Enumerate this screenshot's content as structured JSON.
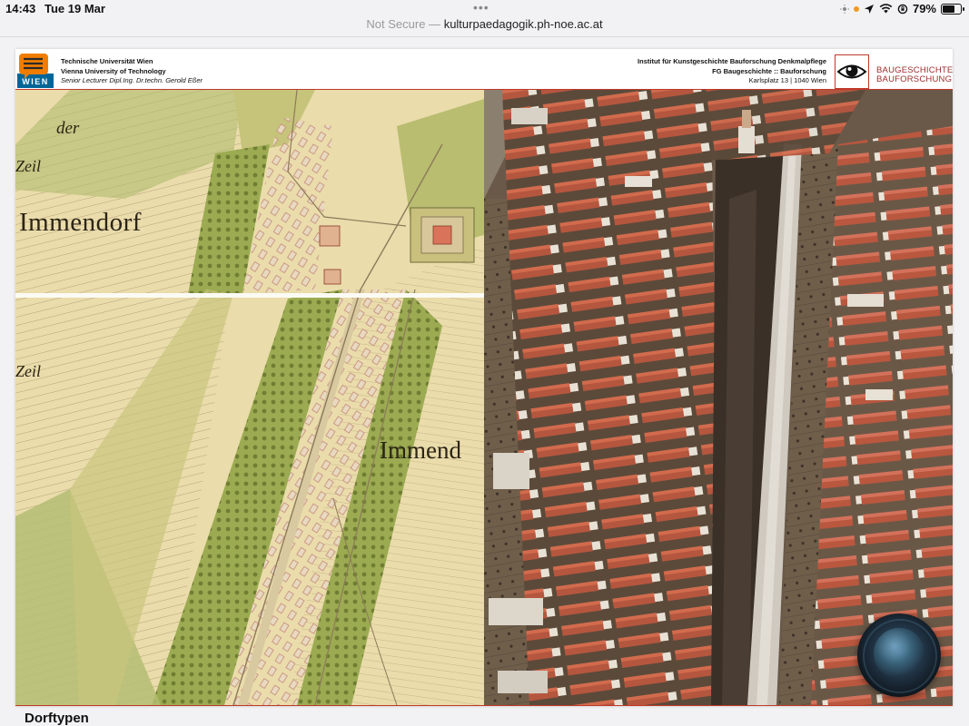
{
  "status_bar": {
    "time": "14:43",
    "date": "Tue 19 Mar",
    "battery": "79%",
    "battery_level": 0.79
  },
  "address_bar": {
    "prefix": "Not Secure —",
    "host": "kulturpaedagogik.ph-noe.ac.at"
  },
  "slide_header": {
    "left_logo_text": "WIEN",
    "left_lines": [
      "Technische Universität Wien",
      "Vienna University of Technology",
      "Senior Lecturer Dipl.Ing. Dr.techn. Gerold Eßer"
    ],
    "right_lines": [
      "Institut für Kunstgeschichte Bauforschung Denkmalpflege",
      "FG Baugeschichte :: Bauforschung",
      "Karlsplatz 13 | 1040 Wien"
    ],
    "right_logo_lines": [
      "BAUGESCHICHTE",
      "BAUFORSCHUNG"
    ]
  },
  "map_labels": {
    "immendorf_top": "Immendorf",
    "immendorf_bottom": "Immend",
    "der": "der",
    "zeil_top": "Zeil",
    "zeil_bottom": "Zeil"
  },
  "caption": "Dorftypen",
  "colors": {
    "accent_red": "#c0392b",
    "tu_orange": "#f07d00",
    "tu_blue": "#006699"
  },
  "icons": {
    "siri": "siri-orb-icon",
    "location": "location-arrow-icon",
    "wifi": "wifi-icon",
    "lock": "orientation-lock-icon",
    "battery": "battery-icon"
  }
}
